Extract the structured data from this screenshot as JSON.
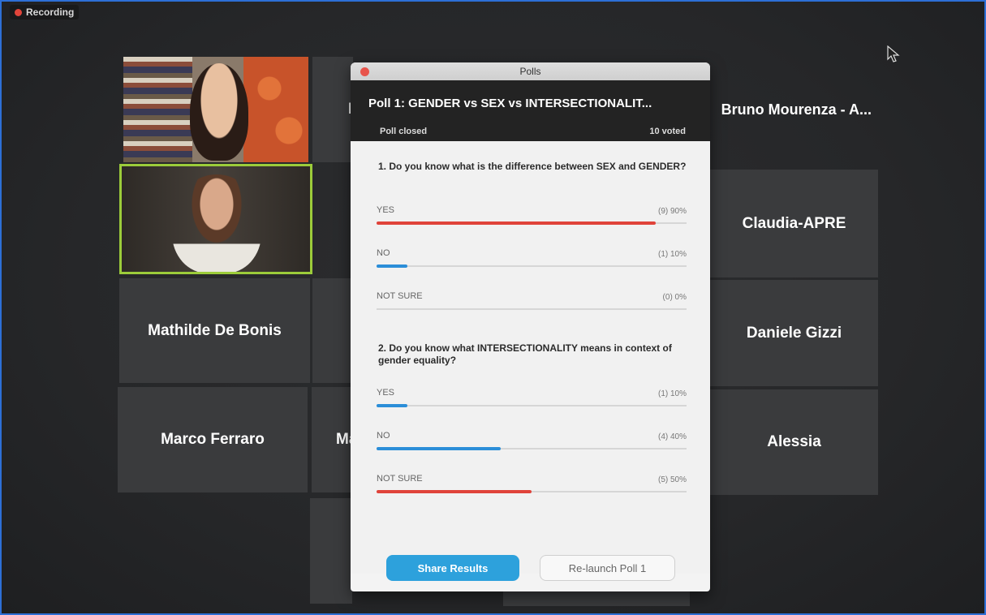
{
  "recording": {
    "label": "Recording"
  },
  "participants": [
    {
      "name": ""
    },
    {
      "name": ""
    },
    {
      "name": "M"
    },
    {
      "name": "Bruno Mourenza - A..."
    },
    {
      "name": "Claudia-APRE"
    },
    {
      "name": "Mathilde De Bonis"
    },
    {
      "name": "Daniele Gizzi"
    },
    {
      "name": "Marco Ferraro"
    },
    {
      "name": "Ma"
    },
    {
      "name": "Alessia"
    }
  ],
  "poll_window": {
    "window_title": "Polls",
    "poll_title": "Poll 1: GENDER vs SEX vs INTERSECTIONALIT...",
    "status": "Poll closed",
    "voted": "10 voted",
    "questions": [
      {
        "text": "1. Do you know what is the difference between SEX and GENDER?",
        "options": [
          {
            "label": "YES",
            "count": "(9) 90%",
            "percent": 90,
            "color": "#e0433a"
          },
          {
            "label": "NO",
            "count": "(1) 10%",
            "percent": 10,
            "color": "#2b8ed8"
          },
          {
            "label": "NOT SURE",
            "count": "(0) 0%",
            "percent": 0,
            "color": "#2b8ed8"
          }
        ]
      },
      {
        "text": "2. Do you know what INTERSECTIONALITY means in context of gender equality?",
        "options": [
          {
            "label": "YES",
            "count": "(1) 10%",
            "percent": 10,
            "color": "#2b8ed8"
          },
          {
            "label": "NO",
            "count": "(4) 40%",
            "percent": 40,
            "color": "#2b8ed8"
          },
          {
            "label": "NOT SURE",
            "count": "(5) 50%",
            "percent": 50,
            "color": "#e0433a"
          }
        ]
      }
    ],
    "buttons": {
      "share": "Share Results",
      "relaunch": "Re-launch Poll 1"
    }
  },
  "colors": {
    "active_speaker_border": "#9ccc3a",
    "recording_dot": "#e0443a",
    "frame_border": "#2d6fd6"
  }
}
